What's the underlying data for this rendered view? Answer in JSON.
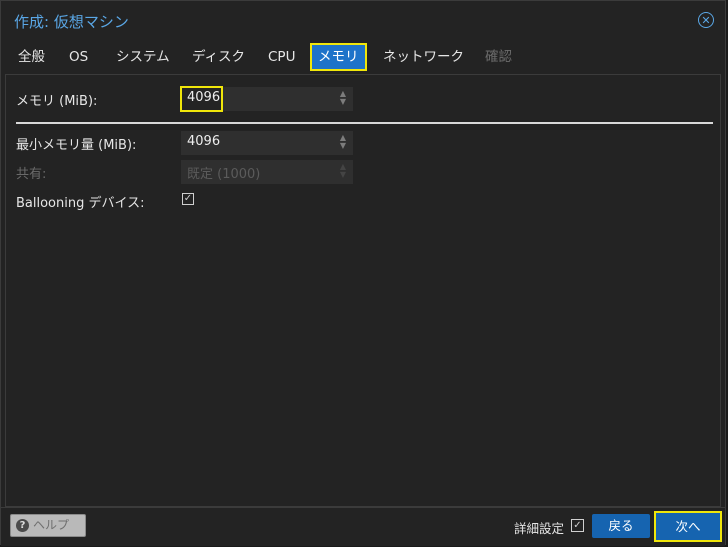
{
  "window": {
    "title": "作成: 仮想マシン",
    "close_icon": "close-circle-icon"
  },
  "tabs": [
    {
      "label": "全般",
      "state": "normal"
    },
    {
      "label": "OS",
      "state": "normal"
    },
    {
      "label": "システム",
      "state": "normal"
    },
    {
      "label": "ディスク",
      "state": "normal"
    },
    {
      "label": "CPU",
      "state": "normal"
    },
    {
      "label": "メモリ",
      "state": "active"
    },
    {
      "label": "ネットワーク",
      "state": "normal"
    },
    {
      "label": "確認",
      "state": "disabled"
    }
  ],
  "form": {
    "memory": {
      "label": "メモリ (MiB):",
      "value": "4096"
    },
    "min_memory": {
      "label": "最小メモリ量 (MiB):",
      "value": "4096"
    },
    "shares": {
      "label": "共有:",
      "value": "既定 (1000)",
      "disabled": true
    },
    "ballooning": {
      "label": "Ballooning デバイス:",
      "checked": true
    }
  },
  "footer": {
    "help_label": "ヘルプ",
    "help_icon": "question-circle-icon",
    "advanced_label": "詳細設定",
    "advanced_checked": true,
    "back_label": "戻る",
    "next_label": "次へ"
  },
  "colors": {
    "accent": "#1e73c9",
    "highlight": "#f0e60a",
    "title": "#5aa7e6"
  }
}
